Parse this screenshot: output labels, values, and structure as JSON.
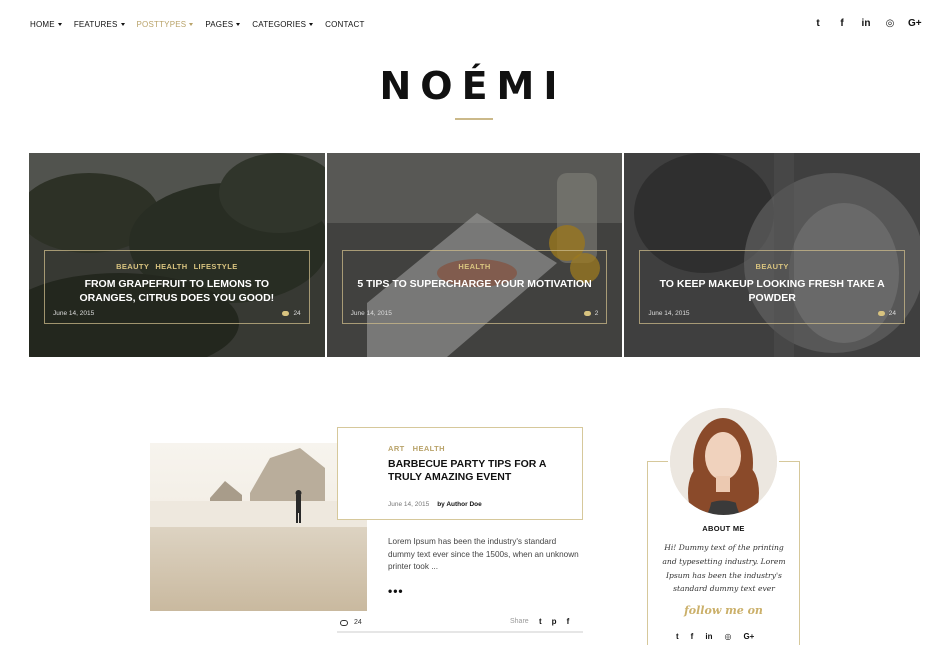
{
  "nav": {
    "items": [
      {
        "label": "HOME",
        "dropdown": true
      },
      {
        "label": "FEATURES",
        "dropdown": true
      },
      {
        "label": "POSTTYPES",
        "dropdown": true,
        "active": true
      },
      {
        "label": "PAGES",
        "dropdown": true
      },
      {
        "label": "CATEGORIES",
        "dropdown": true
      },
      {
        "label": "CONTACT",
        "dropdown": false
      }
    ]
  },
  "social_icons": {
    "twitter": "t",
    "facebook": "f",
    "linkedin": "in",
    "instagram": "◎",
    "google_plus": "G+"
  },
  "brand": {
    "logo": "NOÉMI",
    "accent_color": "#cbb98a"
  },
  "featured": [
    {
      "categories": [
        "BEAUTY",
        "HEALTH",
        "LIFESTYLE"
      ],
      "title": "FROM GRAPEFRUIT TO LEMONS TO ORANGES, CITRUS DOES YOU GOOD!",
      "date": "June 14, 2015",
      "comments": "24"
    },
    {
      "categories": [
        "HEALTH"
      ],
      "title": "5 TIPS TO SUPERCHARGE YOUR MOTIVATION",
      "date": "June 14, 2015",
      "comments": "2"
    },
    {
      "categories": [
        "BEAUTY"
      ],
      "title": "TO KEEP MAKEUP LOOKING FRESH TAKE A POWDER",
      "date": "June 14, 2015",
      "comments": "24"
    }
  ],
  "post": {
    "categories": [
      "ART",
      "HEALTH"
    ],
    "title": "BARBECUE PARTY TIPS FOR A TRULY AMAZING EVENT",
    "date": "June 14, 2015",
    "author": "by Author Doe",
    "excerpt": "Lorem Ipsum has been the industry's standard dummy text ever since the 1500s, when an unknown printer took ...",
    "more": "•••",
    "comments": "24",
    "share_label": "Share",
    "share_icons": {
      "twitter": "t",
      "pinterest": "p",
      "facebook": "f"
    }
  },
  "about": {
    "title": "ABOUT ME",
    "text": "Hi! Dummy text of the printing and typesetting industry. Lorem Ipsum has been the industry's standard dummy text ever",
    "follow": "follow me on",
    "icons": {
      "twitter": "t",
      "facebook": "f",
      "linkedin": "in",
      "instagram": "◎",
      "google_plus": "G+"
    }
  }
}
